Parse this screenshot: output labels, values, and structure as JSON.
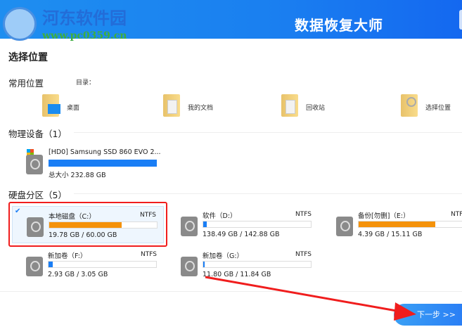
{
  "header": {
    "title": "数据恢复大师",
    "watermark_text": "河东软件园",
    "watermark_url": "www.pc0359.cn"
  },
  "page_title": "选择位置",
  "common": {
    "title": "常用位置",
    "dir_label": "目录：",
    "items": [
      {
        "label": "桌面",
        "icon": "desktop-folder-icon"
      },
      {
        "label": "我的文档",
        "icon": "documents-folder-icon"
      },
      {
        "label": "回收站",
        "icon": "recycle-folder-icon"
      },
      {
        "label": "选择位置",
        "icon": "search-folder-icon"
      }
    ]
  },
  "physical": {
    "title": "物理设备（1）",
    "devices": [
      {
        "name": "[HD0] Samsung SSD 860 EVO 2...",
        "size": "总大小 232.88 GB",
        "fill": 1.0,
        "color": "#1a7ef5"
      }
    ]
  },
  "partitions": {
    "title": "硬盘分区（5）",
    "items": [
      {
        "name": "本地磁盘（C:）",
        "fs": "NTFS",
        "size": "19.78 GB / 60.00 GB",
        "fill": 0.67,
        "color": "#f5920a",
        "selected": true
      },
      {
        "name": "软件（D:）",
        "fs": "NTFS",
        "size": "138.49 GB / 142.88 GB",
        "fill": 0.03,
        "color": "#1a7ef5"
      },
      {
        "name": "备份[勿删]（E:）",
        "fs": "NTFS",
        "size": "4.39 GB / 15.11 GB",
        "fill": 0.71,
        "color": "#f5920a"
      },
      {
        "name": "新加卷（F:）",
        "fs": "NTFS",
        "size": "2.93 GB / 3.05 GB",
        "fill": 0.04,
        "color": "#1a7ef5"
      },
      {
        "name": "新加卷（G:）",
        "fs": "NTFS",
        "size": "11.80 GB / 11.84 GB",
        "fill": 0.004,
        "color": "#1a7ef5"
      }
    ]
  },
  "next_label": "下一步 >>"
}
